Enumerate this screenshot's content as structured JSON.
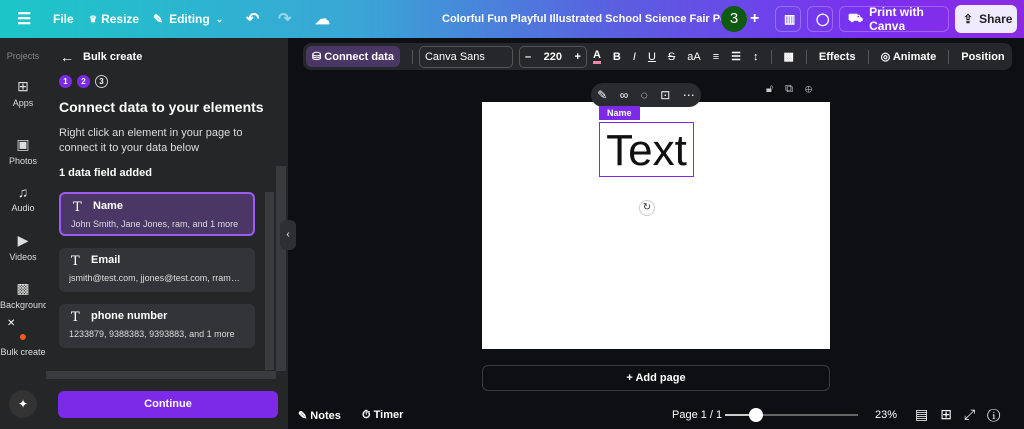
{
  "topbar": {
    "file": "File",
    "resize": "Resize",
    "editing": "Editing",
    "title": "Colorful Fun Playful Illustrated School Science Fair Poster",
    "avatar": "3",
    "print": "Print with Canva",
    "share": "Share"
  },
  "rail": {
    "projects": "Projects",
    "apps": "Apps",
    "photos": "Photos",
    "audio": "Audio",
    "videos": "Videos",
    "background": "Background",
    "bulk": "Bulk create"
  },
  "panel": {
    "back_title": "Bulk create",
    "steps": [
      "1",
      "2",
      "3"
    ],
    "heading": "Connect data to your elements",
    "desc": "Right click an element in your page to connect it to your data below",
    "count": "1 data field added",
    "fields": [
      {
        "name": "Name",
        "values": "John Smith, Jane Jones, ram, and 1 more"
      },
      {
        "name": "Email",
        "values": "jsmith@test.com, jjones@test.com, rram@test.com"
      },
      {
        "name": "phone number",
        "values": "1233879, 9388383, 9393883, and 1 more"
      }
    ],
    "continue": "Continue"
  },
  "toolbar": {
    "connect": "Connect data",
    "font": "Canva Sans",
    "size": "220",
    "effects": "Effects",
    "animate": "Animate",
    "position": "Position"
  },
  "canvas": {
    "label": "Name",
    "text": "Text",
    "add_page": "+ Add page"
  },
  "bottom": {
    "notes": "Notes",
    "timer": "Timer",
    "page": "Page 1 / 1",
    "zoom": "23%",
    "zoom_value": 23
  }
}
